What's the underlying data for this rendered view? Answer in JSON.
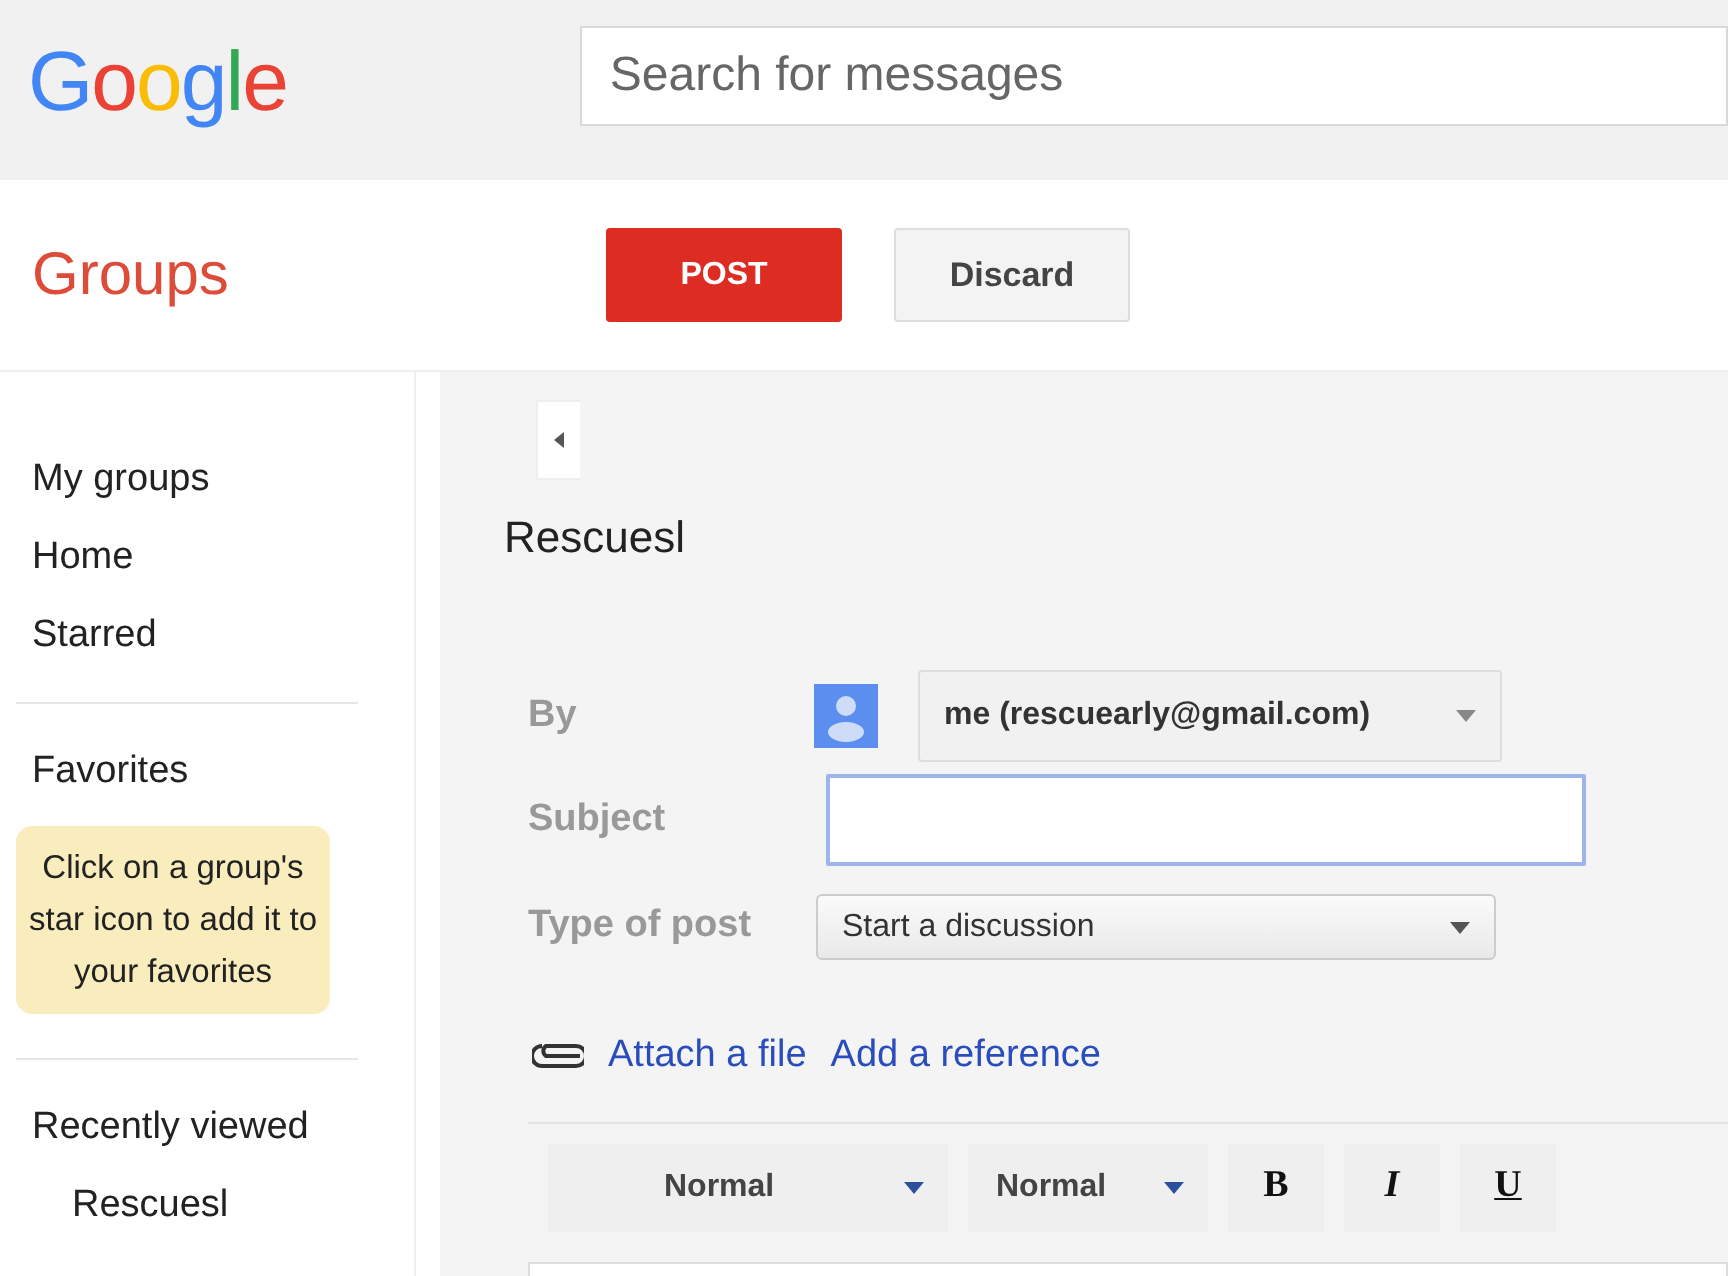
{
  "header": {
    "logo": "Google",
    "search": {
      "placeholder": "Search for messages"
    }
  },
  "app_title": "Groups",
  "actions": [
    {
      "label": "POST",
      "kind": "primary"
    },
    {
      "label": "Discard",
      "kind": "secondary"
    }
  ],
  "sidebar": {
    "nav": [
      {
        "label": "My groups"
      },
      {
        "label": "Home"
      },
      {
        "label": "Starred"
      }
    ],
    "favorites": {
      "heading": "Favorites",
      "hint": "Click on a group's star icon to add it to your favorites"
    },
    "recent": {
      "heading": "Recently viewed",
      "items": [
        {
          "label": "Rescuesl"
        }
      ]
    }
  },
  "compose": {
    "group": "Rescuesl",
    "by": {
      "label": "By",
      "value": "me (rescuearly@gmail.com)"
    },
    "subject": {
      "label": "Subject",
      "focused": true
    },
    "type": {
      "label": "Type of post",
      "value": "Start a discussion"
    },
    "links": [
      "Attach a file",
      "Add a reference"
    ],
    "toolbar": [
      {
        "label": "Normal",
        "kind": "dropdown"
      },
      {
        "label": "Normal",
        "kind": "dropdown"
      },
      {
        "label": "B",
        "kind": "bold"
      },
      {
        "label": "I",
        "kind": "italic"
      },
      {
        "label": "U",
        "kind": "underline"
      }
    ]
  }
}
